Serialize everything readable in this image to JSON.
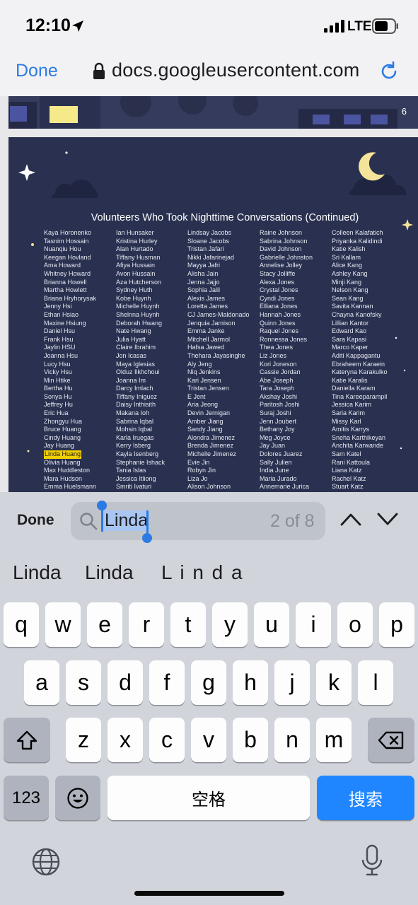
{
  "status_bar": {
    "time": "12:10",
    "network": "LTE"
  },
  "browser": {
    "done_label": "Done",
    "url": "docs.googleusercontent.com"
  },
  "document": {
    "page_number": "6",
    "title": "Volunteers Who Took Nighttime Conversations (Continued)",
    "name_columns": [
      [
        "Kaya Horonenko",
        "Tasnim Hossain",
        "Nuanqiu Hou",
        "Keegan Hovland",
        "Ama Howard",
        "Whitney Howard",
        "Brianna Howell",
        "Martha Howlett",
        "Briana Hryhorysak",
        "Jenny Hsi",
        "Ethan Hsiao",
        "Maxine Hsiung",
        "Daniel Hsu",
        "Frank Hsu",
        "Jaylin HSU",
        "Joanna Hsu",
        "Lucy Hsu",
        "Vicky Hsu",
        "Min Htike",
        "Bertha Hu",
        "Sonya Hu",
        "Jeffrey Hu",
        "Eric Hua",
        "Zhongyu Hua",
        "Bruce Huang",
        "Cindy Huang",
        "Jay Huang",
        "Linda Huang",
        "Olivia Huang",
        "Max Huddleston",
        "Mara Hudson",
        "Emma Huelsmann"
      ],
      [
        "Ian Hunsaker",
        "Kristina Hurley",
        "Alan Hurtado",
        "Tiffany Husman",
        "Afiya Hussain",
        "Avon Hussain",
        "Aza Hutcherson",
        "Sydney Huth",
        "Kobe Huynh",
        "Michelle Huynh",
        "Shelnna Huynh",
        "Deborah Hwang",
        "Nate Hwang",
        "Julia Hyatt",
        "Claire Ibrahim",
        "Jon Icasas",
        "Maya Iglesias",
        "Olduz Ilkhchoui",
        "Joanna Im",
        "Darcy Imlach",
        "Tiffany Iniguez",
        "Daisy Inthisith",
        "Makana Ioh",
        "Sabrina Iqbal",
        "Mohsin Iqbal",
        "Karla Iruegas",
        "Kerry Isberg",
        "Kayla Isenberg",
        "Stephanie Ishack",
        "Tania Islas",
        "Jessica Itliong",
        "Smriti Ivaturi"
      ],
      [
        "Lindsay Jacobs",
        "Sloane Jacobs",
        "Tristan Jafari",
        "Nikki Jafarinejad",
        "Mayya Jafri",
        "Alisha Jain",
        "Jenna Jajjo",
        "Sophia Jalil",
        "Alexis James",
        "Loretta James",
        "CJ James-Maldonado",
        "Jenquia Jamison",
        "Emma Janke",
        "Mitchell Jarmol",
        "Hafsa Jawed",
        "Thehara Jayasinghe",
        "Aly Jeng",
        "Niq Jenkins",
        "Kari Jensen",
        "Tristan Jensen",
        "E Jent",
        "Aria Jeong",
        "Devin Jernigan",
        "Amber Jiang",
        "Sandy Jiang",
        "Alondra Jimenez",
        "Brenda Jimenez",
        "Michelle Jimenez",
        "Evie Jin",
        "Robyn Jin",
        "Liza Jo",
        "Alison Johnson"
      ],
      [
        "Raine Johnson",
        "Sabrina Johnson",
        "David Johnson",
        "Gabrielle Johnston",
        "Annelise Jolley",
        "Stacy Jolliffe",
        "Alexa Jones",
        "Crystal Jones",
        "Cyndi Jones",
        "Elliana Jones",
        "Hannah Jones",
        "Quinn Jones",
        "Raquel Jones",
        "Ronnessa Jones",
        "Thea Jones",
        "Liz Jones",
        "Kori Joneson",
        "Cassie Jordan",
        "Abe Joseph",
        "Tara Joseph",
        "Akshay Joshi",
        "Paritosh Joshi",
        "Suraj Joshi",
        "Jenn Joubert",
        "Bethany Joy",
        "Meg Joyce",
        "Jay Juan",
        "Dolores Juarez",
        "Sally Julien",
        "India June",
        "Maria Jurado",
        "Annemarie Jurica"
      ],
      [
        "Colleen Kalafatich",
        "Priyanka Kalidindi",
        "Katie Kalish",
        "Sri Kallam",
        "Alice Kang",
        "Ashley Kang",
        "Minji Kang",
        "Nelson Kang",
        "Sean Kang",
        "Savita Kannan",
        "Chayna Kanofsky",
        "Lillian Kantor",
        "Edward Kao",
        "Sara Kapasi",
        "Marco Kaper",
        "Aditi Kappagantu",
        "Ebraheem Karaein",
        "Kateryna Karakulko",
        "Katie Karalis",
        "Daniella Karam",
        "Tina Kareeparampil",
        "Jessica Karim",
        "Saria Karim",
        "Missy Karl",
        "Amitis Karrys",
        "Sneha Karthikeyan",
        "Anchita Karwande",
        "Sam Katel",
        "Rani Kattoula",
        "Liana Katz",
        "Rachel Katz",
        "Stuart Katz"
      ]
    ],
    "highlighted_name": "Linda Huang"
  },
  "find_bar": {
    "done_label": "Done",
    "query": "Linda",
    "match_count": "2 of 8"
  },
  "suggestions": [
    "Linda",
    "Linda",
    "L i n d a"
  ],
  "keyboard": {
    "row1": [
      "q",
      "w",
      "e",
      "r",
      "t",
      "y",
      "u",
      "i",
      "o",
      "p"
    ],
    "row2": [
      "a",
      "s",
      "d",
      "f",
      "g",
      "h",
      "j",
      "k",
      "l"
    ],
    "row3": [
      "z",
      "x",
      "c",
      "v",
      "b",
      "n",
      "m"
    ],
    "numbers_label": "123",
    "space_label": "空格",
    "search_label": "搜索"
  },
  "colors": {
    "accent": "#2c7be5",
    "highlight": "#f2d000",
    "doc_background": "#2a3150",
    "search_key": "#1f86ff"
  }
}
